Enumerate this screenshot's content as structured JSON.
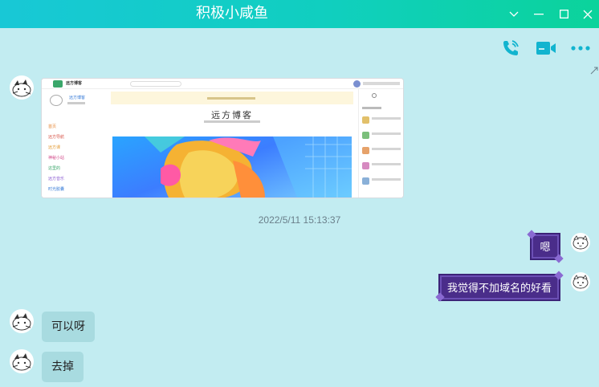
{
  "window": {
    "title": "积极小咸鱼",
    "controls": [
      "chevron-down-icon",
      "minimize-icon",
      "maximize-icon",
      "close-icon"
    ]
  },
  "toolbar": {
    "actions": [
      "phone-icon",
      "video-call-icon",
      "more-icon"
    ]
  },
  "colors": {
    "titlebar_start": "#18c8d6",
    "titlebar_end": "#0bd39b",
    "background": "#c2ecf1",
    "icon_accent": "#12b4cf",
    "bubble_purple": "#4a2d8a",
    "bubble_teal": "#a8dbe0"
  },
  "messages": [
    {
      "side": "left",
      "type": "image",
      "screenshot": {
        "site_name": "远方博客",
        "blog_title": "远方博客",
        "nav": [
          "首页",
          "远方导航",
          "远方课",
          "神秘小站",
          "这里的",
          "远方音乐",
          "时光胶囊"
        ]
      }
    },
    {
      "side": "center",
      "type": "timestamp",
      "text": "2022/5/11 15:13:37"
    },
    {
      "side": "right",
      "type": "text",
      "text": "嗯"
    },
    {
      "side": "right",
      "type": "text",
      "text": "我觉得不加域名的好看"
    },
    {
      "side": "left",
      "type": "text",
      "text": "可以呀"
    },
    {
      "side": "left",
      "type": "text",
      "text": "去掉"
    }
  ]
}
